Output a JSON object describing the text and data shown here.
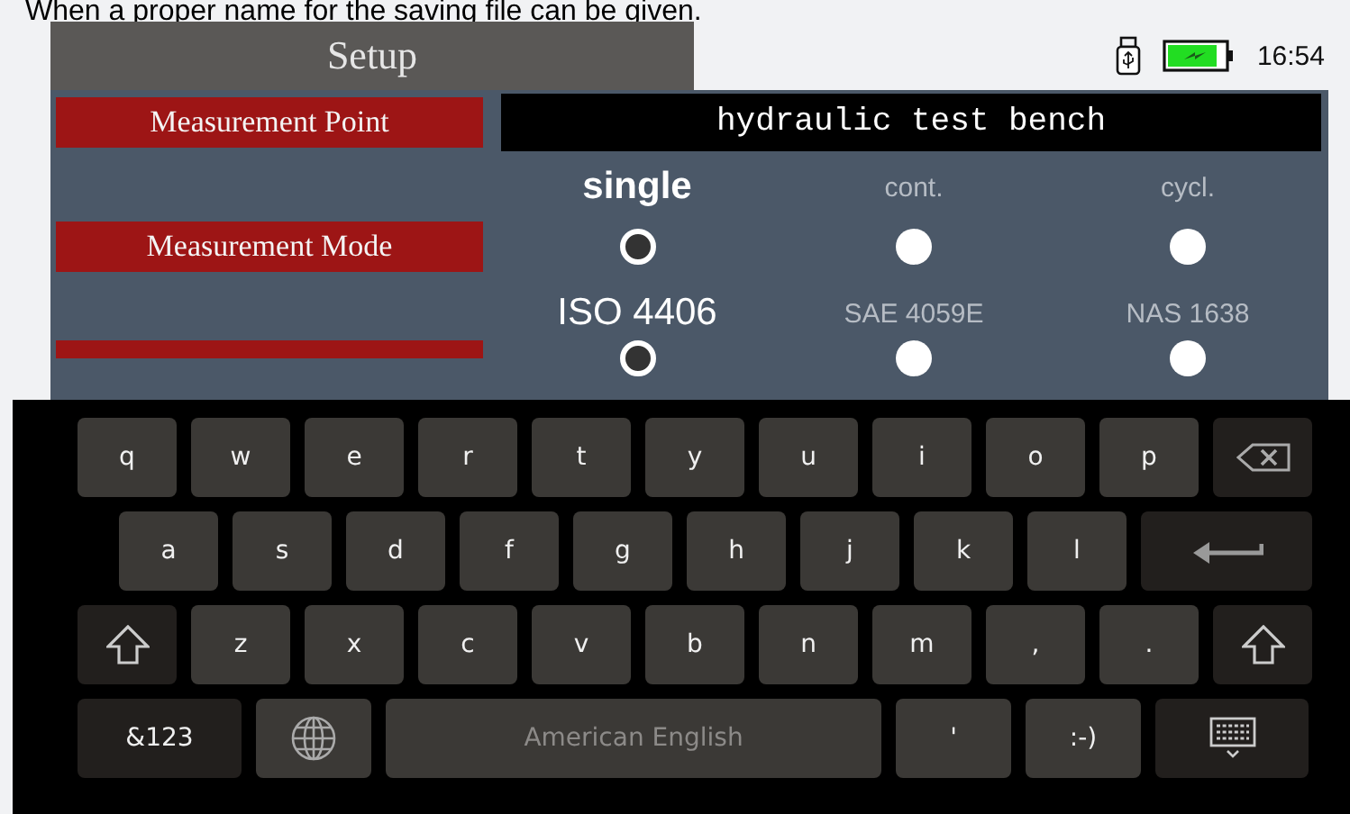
{
  "caption": "When a proper name for the saving file can be given.",
  "header": {
    "tab": "Setup",
    "time": "16:54"
  },
  "measurement_point": {
    "label": "Measurement Point",
    "value": "hydraulic test bench"
  },
  "measurement_mode": {
    "label": "Measurement Mode",
    "options": [
      {
        "label": "single",
        "selected": true
      },
      {
        "label": "cont.",
        "selected": false
      },
      {
        "label": "cycl.",
        "selected": false
      }
    ]
  },
  "standard": {
    "options": [
      {
        "label": "ISO 4406",
        "selected": true
      },
      {
        "label": "SAE 4059E",
        "selected": false
      },
      {
        "label": "NAS 1638",
        "selected": false
      }
    ]
  },
  "keyboard": {
    "letter_rows": [
      [
        {
          "kind": "char",
          "label": "q"
        },
        {
          "kind": "char",
          "label": "w"
        },
        {
          "kind": "char",
          "label": "e"
        },
        {
          "kind": "char",
          "label": "r"
        },
        {
          "kind": "char",
          "label": "t"
        },
        {
          "kind": "char",
          "label": "y"
        },
        {
          "kind": "char",
          "label": "u"
        },
        {
          "kind": "char",
          "label": "i"
        },
        {
          "kind": "char",
          "label": "o"
        },
        {
          "kind": "char",
          "label": "p"
        },
        {
          "kind": "backspace"
        }
      ],
      [
        {
          "kind": "char",
          "label": "a"
        },
        {
          "kind": "char",
          "label": "s"
        },
        {
          "kind": "char",
          "label": "d"
        },
        {
          "kind": "char",
          "label": "f"
        },
        {
          "kind": "char",
          "label": "g"
        },
        {
          "kind": "char",
          "label": "h"
        },
        {
          "kind": "char",
          "label": "j"
        },
        {
          "kind": "char",
          "label": "k"
        },
        {
          "kind": "char",
          "label": "l"
        },
        {
          "kind": "enter"
        }
      ],
      [
        {
          "kind": "shift"
        },
        {
          "kind": "char",
          "label": "z"
        },
        {
          "kind": "char",
          "label": "x"
        },
        {
          "kind": "char",
          "label": "c"
        },
        {
          "kind": "char",
          "label": "v"
        },
        {
          "kind": "char",
          "label": "b"
        },
        {
          "kind": "char",
          "label": "n"
        },
        {
          "kind": "char",
          "label": "m"
        },
        {
          "kind": "char",
          "label": ","
        },
        {
          "kind": "char",
          "label": "."
        },
        {
          "kind": "shift"
        }
      ]
    ],
    "bottom_row": [
      {
        "kind": "symbols",
        "label": "&123"
      },
      {
        "kind": "globe"
      },
      {
        "kind": "space",
        "label": "American English"
      },
      {
        "kind": "char",
        "label": "'"
      },
      {
        "kind": "char",
        "label": ":-)"
      },
      {
        "kind": "hide"
      }
    ]
  }
}
